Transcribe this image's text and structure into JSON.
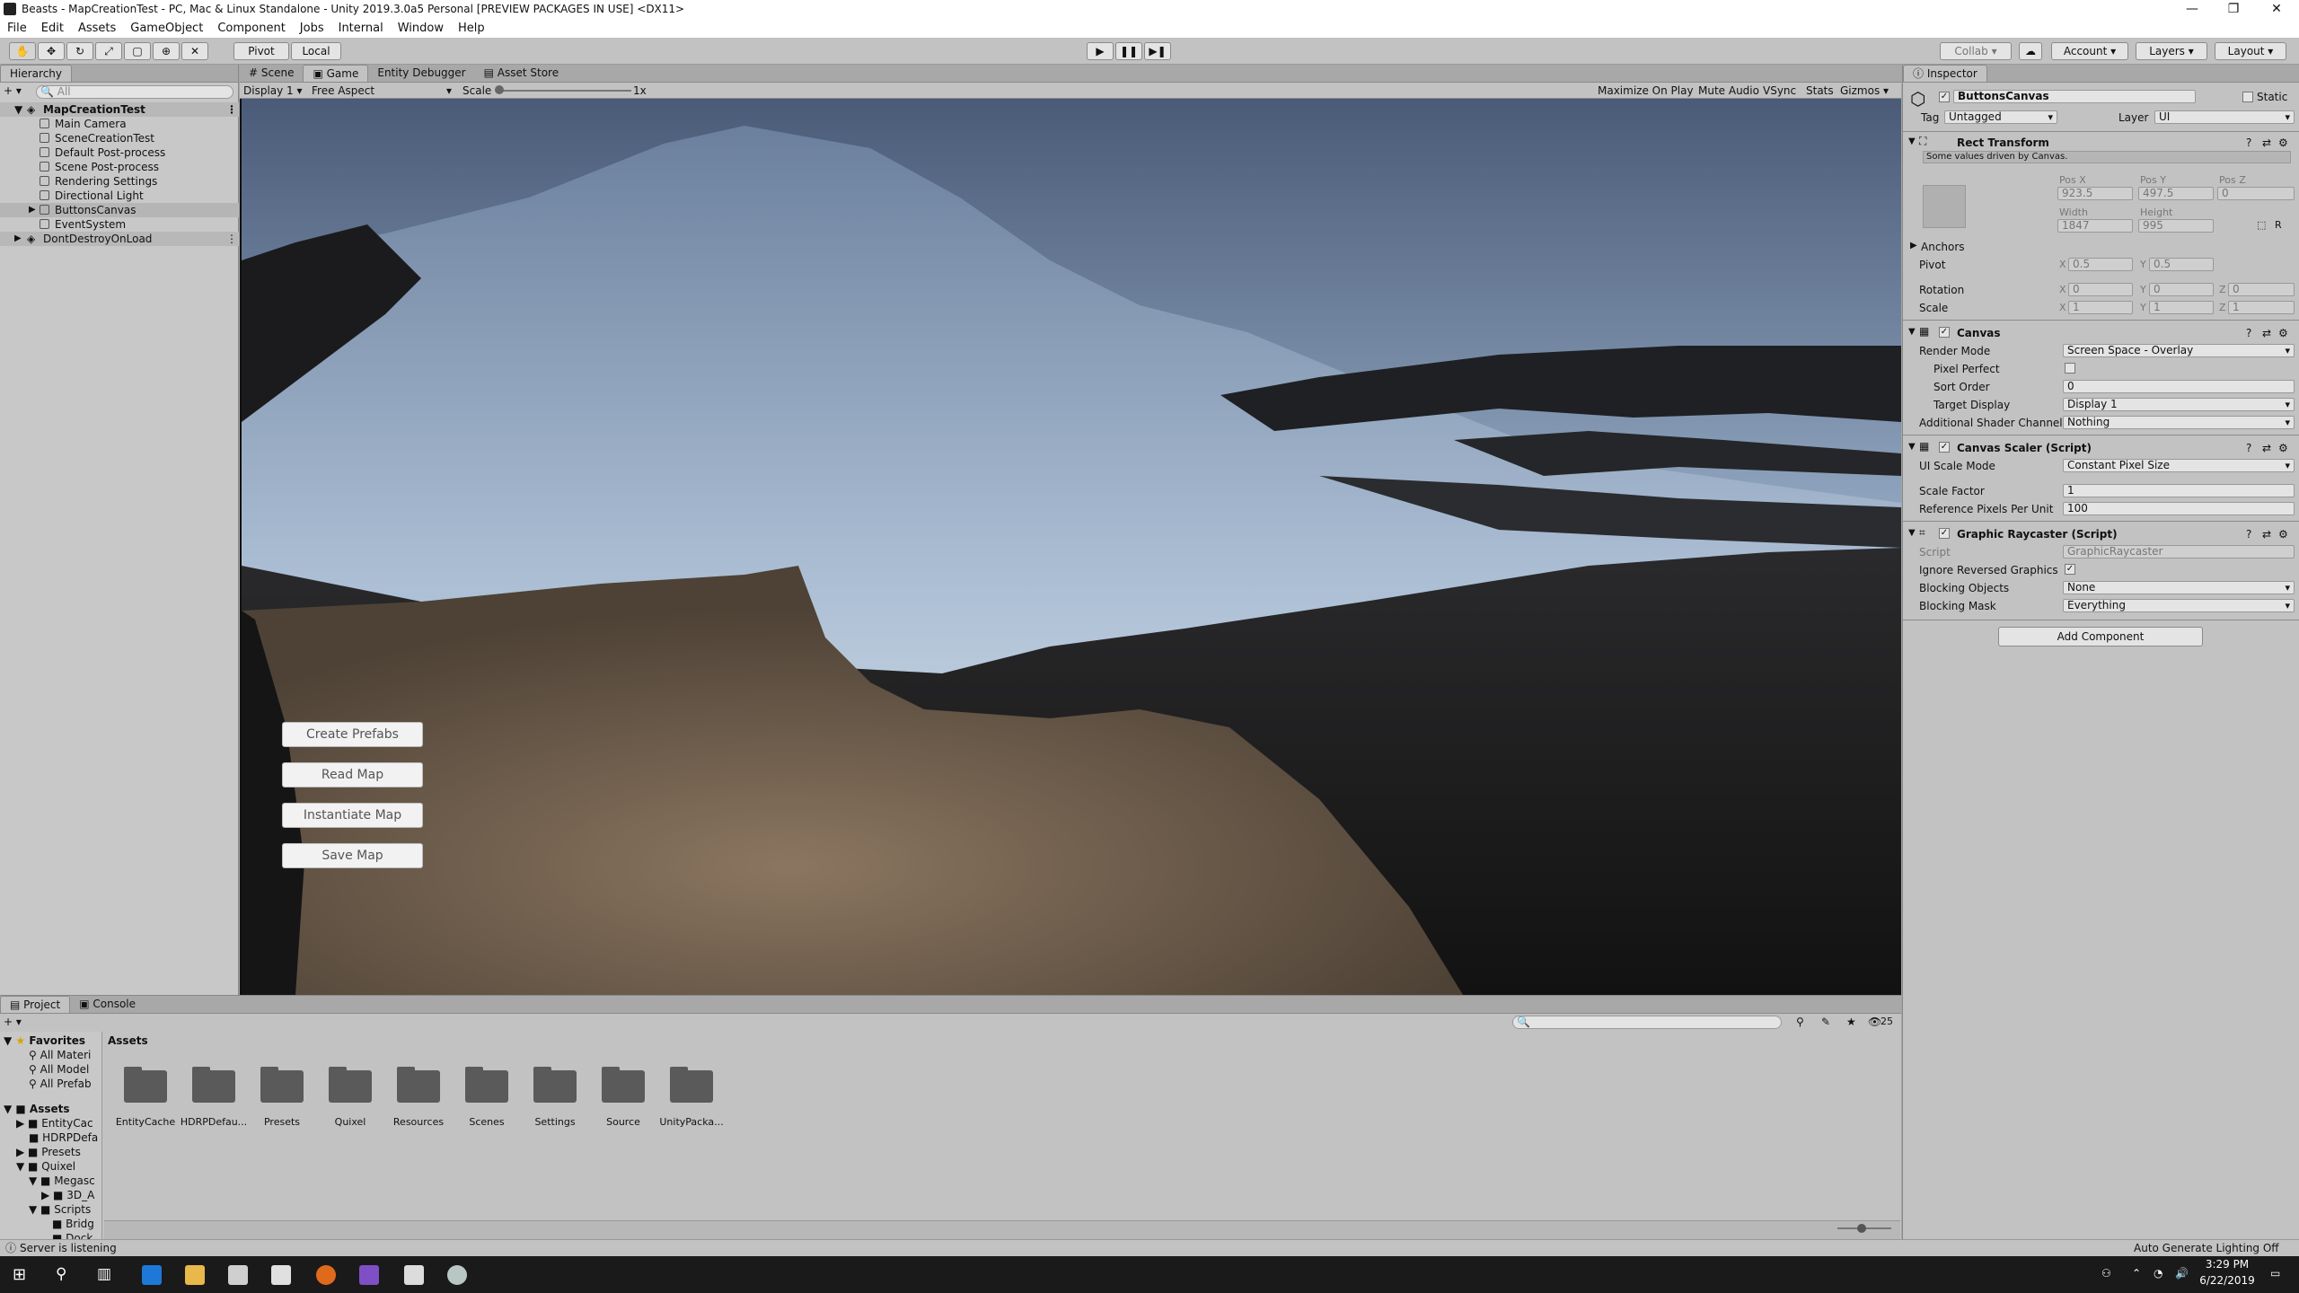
{
  "window": {
    "title": "Beasts - MapCreationTest - PC, Mac & Linux Standalone - Unity 2019.3.0a5 Personal [PREVIEW PACKAGES IN USE] <DX11>"
  },
  "menu": [
    "File",
    "Edit",
    "Assets",
    "GameObject",
    "Component",
    "Jobs",
    "Internal",
    "Window",
    "Help"
  ],
  "toolbar": {
    "pivot": "Pivot",
    "local": "Local",
    "collab": "Collab",
    "account": "Account",
    "layers": "Layers",
    "layout": "Layout"
  },
  "hierarchy": {
    "tab": "Hierarchy",
    "search": "All",
    "scene": "MapCreationTest",
    "items": [
      "Main Camera",
      "SceneCreationTest",
      "Default Post-process",
      "Scene Post-process",
      "Rendering Settings",
      "Directional Light",
      "ButtonsCanvas",
      "EventSystem"
    ],
    "dontdestroy": "DontDestroyOnLoad"
  },
  "center_tabs": [
    "Scene",
    "Game",
    "Entity Debugger",
    "Asset Store"
  ],
  "gamebar": {
    "display": "Display 1",
    "aspect": "Free Aspect",
    "scale_label": "Scale",
    "scale_value": "1x",
    "options": [
      "Maximize On Play",
      "Mute Audio",
      "VSync",
      "Stats",
      "Gizmos"
    ]
  },
  "game_buttons": [
    "Create Prefabs",
    "Read Map",
    "Instantiate Map",
    "Save Map"
  ],
  "inspector": {
    "tab": "Inspector",
    "object": "ButtonsCanvas",
    "static": "Static",
    "tag_label": "Tag",
    "tag": "Untagged",
    "layer_label": "Layer",
    "layer": "UI",
    "rect": {
      "title": "Rect Transform",
      "note": "Some values driven by Canvas.",
      "posx_l": "Pos X",
      "posy_l": "Pos Y",
      "posz_l": "Pos Z",
      "posx": "923.5",
      "posy": "497.5",
      "posz": "0",
      "width_l": "Width",
      "height_l": "Height",
      "width": "1847",
      "height": "995",
      "anchors": "Anchors",
      "pivot": "Pivot",
      "pivx": "0.5",
      "pivy": "0.5",
      "rotation": "Rotation",
      "rx": "0",
      "ry": "0",
      "rz": "0",
      "scale": "Scale",
      "sx": "1",
      "sy": "1",
      "sz": "1",
      "R": "R",
      "X": "X",
      "Y": "Y",
      "Z": "Z"
    },
    "canvas": {
      "title": "Canvas",
      "render_mode_l": "Render Mode",
      "render_mode": "Screen Space - Overlay",
      "pixel_perfect_l": "Pixel Perfect",
      "sort_order_l": "Sort Order",
      "sort_order": "0",
      "target_display_l": "Target Display",
      "target_display": "Display 1",
      "shader_channels_l": "Additional Shader Channels",
      "shader_channels": "Nothing"
    },
    "scaler": {
      "title": "Canvas Scaler (Script)",
      "mode_l": "UI Scale Mode",
      "mode": "Constant Pixel Size",
      "factor_l": "Scale Factor",
      "factor": "1",
      "ppu_l": "Reference Pixels Per Unit",
      "ppu": "100"
    },
    "raycaster": {
      "title": "Graphic Raycaster (Script)",
      "script_l": "Script",
      "script": "GraphicRaycaster",
      "ignore_l": "Ignore Reversed Graphics",
      "blocking_l": "Blocking Objects",
      "blocking": "None",
      "mask_l": "Blocking Mask",
      "mask": "Everything"
    },
    "add_component": "Add Component"
  },
  "project": {
    "tabs": [
      "Project",
      "Console"
    ],
    "count": "25",
    "favorites": "Favorites",
    "fav_items": [
      "All Materi",
      "All Model",
      "All Prefab"
    ],
    "assets_label": "Assets",
    "tree": [
      "EntityCac",
      "HDRPDefa",
      "Presets",
      "Quixel",
      "Megasc",
      "3D_A",
      "Scripts",
      "Bridg",
      "Dock"
    ],
    "breadcrumb": "Assets",
    "folders": [
      "EntityCache",
      "HDRPDefau...",
      "Presets",
      "Quixel",
      "Resources",
      "Scenes",
      "Settings",
      "Source",
      "UnityPacka..."
    ]
  },
  "status": {
    "left": "Server is listening",
    "right": "Auto Generate Lighting Off"
  },
  "taskbar": {
    "time": "3:29 PM",
    "date": "6/22/2019"
  },
  "colors": {
    "accent": "#3a7bd5",
    "sky_top": "#4a5b77",
    "ground": "#8b7660"
  }
}
